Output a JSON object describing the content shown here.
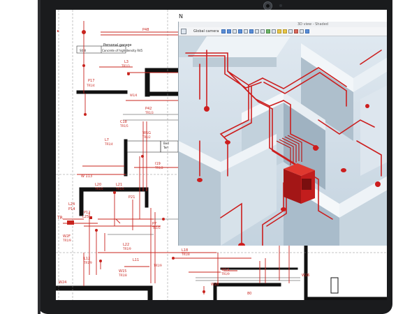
{
  "plan": {
    "north_marker": "N",
    "garage_title": "Personal garage",
    "garage_spec": "Concrete of high density R45",
    "garage_code": "S0.8",
    "p48": "P48",
    "l3": "L3",
    "l3_sub": "TR1/3",
    "p17": "P17",
    "p17_sub": "TR1/4",
    "c18": "C18",
    "c18_sub": "TR1/5",
    "p42": "P42",
    "p42_sub": "TR1/3",
    "w1g": "W1G",
    "w1g_sub": "TR1/2",
    "l7": "L7",
    "l7_sub": "TR1/4",
    "terr": "Terr",
    "bed": "Bed",
    "w13": "W 113",
    "i19": "I19",
    "i19_sub": "TR1/2",
    "p21": "P21",
    "l21": "L21",
    "l21_sub": "TR1/5",
    "l20": "L20",
    "l20_sub": "TR1/5",
    "p14": "P14",
    "l24": "L24",
    "l25": "L25",
    "p12": "P12",
    "p7": "P7",
    "p7_sub": "TR1/5",
    "tr": "TR",
    "w2f": "W2F",
    "tr19": "TR1/9",
    "l22": "L22",
    "l22_sub": "TR1/9",
    "l12": "L12",
    "l12_sub": "TR1/9",
    "l11": "L11",
    "l11_sub": "TR1/9",
    "l18": "L18",
    "l18_sub": "TR1/8",
    "w19": "W19",
    "w19_sub": "TR1/9",
    "w24": "W24",
    "w28": "W28",
    "w26": "W26",
    "mark_80": "80",
    "w15": "W15",
    "w15_sub": "TR1/8"
  },
  "viewer": {
    "window_title": "3D view - Shaded",
    "toolbar_label": "Global camera"
  },
  "colors": {
    "device_frame": "#1a1b1d",
    "plan_red": "#c8241e",
    "wall_black": "#111111",
    "pipe_red": "#cc1e1e"
  },
  "icons": {
    "camera": "front-camera-icon",
    "toolbar": [
      "camera-select-icon",
      "pan-icon",
      "orbit-icon",
      "zoom-icon",
      "zoom-window-icon",
      "zoom-extents-icon",
      "walk-icon",
      "section-icon",
      "render-icon",
      "light-icon",
      "settings-icon",
      "layers-icon",
      "filter-icon",
      "measure-icon",
      "hide-icon",
      "isolate-icon",
      "reset-icon"
    ]
  }
}
